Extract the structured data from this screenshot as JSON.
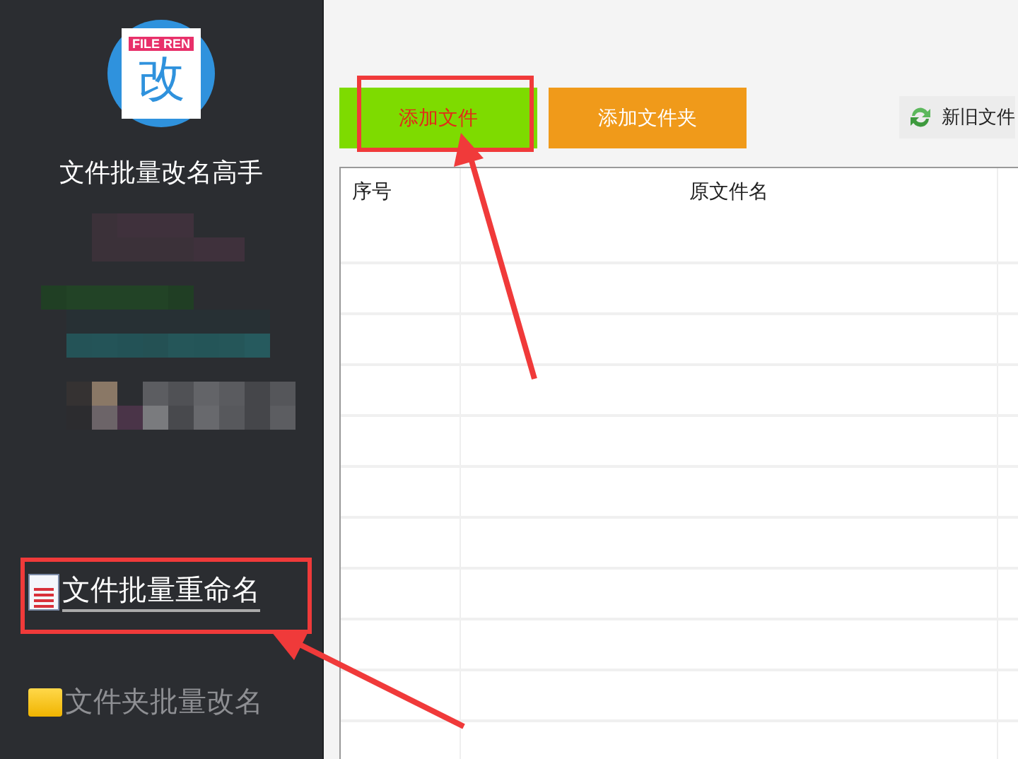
{
  "app": {
    "title": "文件批量改名高手",
    "logo_tag": "FILE REN",
    "logo_glyph": "改"
  },
  "sidebar": {
    "nav": [
      {
        "label": "文件批量重命名",
        "kind": "document",
        "selected": true
      },
      {
        "label": "文件夹批量改名",
        "kind": "folder",
        "selected": false
      }
    ]
  },
  "toolbar": {
    "buttons": [
      {
        "label": "添加文件",
        "kind": "green"
      },
      {
        "label": "添加文件夹",
        "kind": "orange"
      },
      {
        "label": "新旧文件",
        "kind": "refresh"
      }
    ]
  },
  "table": {
    "columns": [
      "序号",
      "原文件名"
    ]
  }
}
